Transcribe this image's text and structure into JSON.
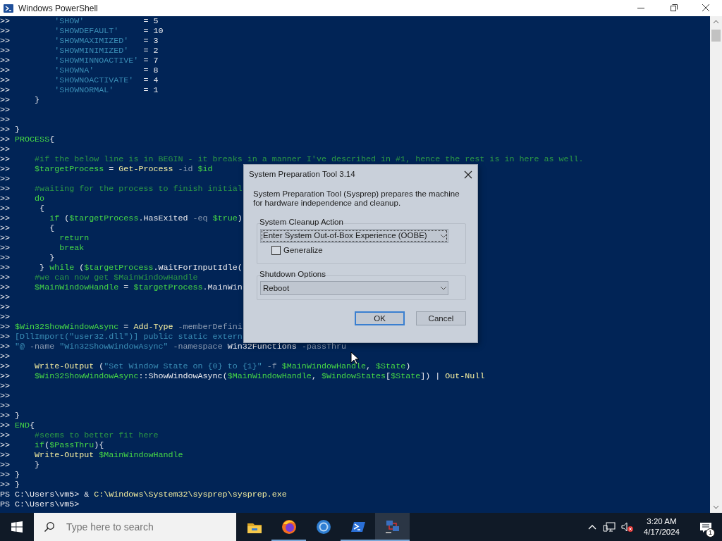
{
  "window": {
    "title": "Windows PowerShell"
  },
  "console": {
    "lines": [
      {
        "segments": [
          {
            "kind": "plain",
            "text": ">>         "
          },
          {
            "kind": "string",
            "text": "'SHOW'"
          },
          {
            "kind": "plain",
            "text": "            = 5"
          }
        ]
      },
      {
        "segments": [
          {
            "kind": "plain",
            "text": ">>         "
          },
          {
            "kind": "string",
            "text": "'SHOWDEFAULT'"
          },
          {
            "kind": "plain",
            "text": "     = 10"
          }
        ]
      },
      {
        "segments": [
          {
            "kind": "plain",
            "text": ">>         "
          },
          {
            "kind": "string",
            "text": "'SHOWMAXIMIZED'"
          },
          {
            "kind": "plain",
            "text": "   = 3"
          }
        ]
      },
      {
        "segments": [
          {
            "kind": "plain",
            "text": ">>         "
          },
          {
            "kind": "string",
            "text": "'SHOWMINIMIZED'"
          },
          {
            "kind": "plain",
            "text": "   = 2"
          }
        ]
      },
      {
        "segments": [
          {
            "kind": "plain",
            "text": ">>         "
          },
          {
            "kind": "string",
            "text": "'SHOWMINNOACTIVE'"
          },
          {
            "kind": "plain",
            "text": " = 7"
          }
        ]
      },
      {
        "segments": [
          {
            "kind": "plain",
            "text": ">>         "
          },
          {
            "kind": "string",
            "text": "'SHOWNA'"
          },
          {
            "kind": "plain",
            "text": "          = 8"
          }
        ]
      },
      {
        "segments": [
          {
            "kind": "plain",
            "text": ">>         "
          },
          {
            "kind": "string",
            "text": "'SHOWNOACTIVATE'"
          },
          {
            "kind": "plain",
            "text": "  = 4"
          }
        ]
      },
      {
        "segments": [
          {
            "kind": "plain",
            "text": ">>         "
          },
          {
            "kind": "string",
            "text": "'SHOWNORMAL'"
          },
          {
            "kind": "plain",
            "text": "      = 1"
          }
        ]
      },
      {
        "segments": [
          {
            "kind": "plain",
            "text": ">>     }"
          }
        ]
      },
      {
        "segments": [
          {
            "kind": "plain",
            "text": ">>"
          }
        ]
      },
      {
        "segments": [
          {
            "kind": "plain",
            "text": ">>"
          }
        ]
      },
      {
        "segments": [
          {
            "kind": "plain",
            "text": ">> }"
          }
        ]
      },
      {
        "segments": [
          {
            "kind": "plain",
            "text": ">> "
          },
          {
            "kind": "keyword",
            "text": "PROCESS"
          },
          {
            "kind": "plain",
            "text": "{"
          }
        ]
      },
      {
        "segments": [
          {
            "kind": "plain",
            "text": ">>"
          }
        ]
      },
      {
        "segments": [
          {
            "kind": "plain",
            "text": ">>     "
          },
          {
            "kind": "comment",
            "text": "#if the below line is in BEGIN - it breaks in a manner I've described in #1, hence the rest is in here as well."
          }
        ]
      },
      {
        "segments": [
          {
            "kind": "plain",
            "text": ">>     "
          },
          {
            "kind": "variable",
            "text": "$targetProcess"
          },
          {
            "kind": "plain",
            "text": " = "
          },
          {
            "kind": "command",
            "text": "Get-Process"
          },
          {
            "kind": "param",
            "text": " -id "
          },
          {
            "kind": "variable",
            "text": "$id"
          }
        ]
      },
      {
        "segments": [
          {
            "kind": "plain",
            "text": ">>"
          }
        ]
      },
      {
        "segments": [
          {
            "kind": "plain",
            "text": ">>     "
          },
          {
            "kind": "comment",
            "text": "#waiting for the process to finish initial"
          }
        ]
      },
      {
        "segments": [
          {
            "kind": "plain",
            "text": ">>     "
          },
          {
            "kind": "keyword",
            "text": "do"
          }
        ]
      },
      {
        "segments": [
          {
            "kind": "plain",
            "text": ">>      {"
          }
        ]
      },
      {
        "segments": [
          {
            "kind": "plain",
            "text": ">>        "
          },
          {
            "kind": "keyword",
            "text": "if"
          },
          {
            "kind": "plain",
            "text": " ("
          },
          {
            "kind": "variable",
            "text": "$targetProcess"
          },
          {
            "kind": "plain",
            "text": ".HasExited"
          },
          {
            "kind": "param",
            "text": " -eq "
          },
          {
            "kind": "variable",
            "text": "$true"
          },
          {
            "kind": "plain",
            "text": ")"
          }
        ]
      },
      {
        "segments": [
          {
            "kind": "plain",
            "text": ">>        {"
          }
        ]
      },
      {
        "segments": [
          {
            "kind": "plain",
            "text": ">>          "
          },
          {
            "kind": "keyword",
            "text": "return"
          }
        ]
      },
      {
        "segments": [
          {
            "kind": "plain",
            "text": ">>          "
          },
          {
            "kind": "keyword",
            "text": "break"
          }
        ]
      },
      {
        "segments": [
          {
            "kind": "plain",
            "text": ">>        }"
          }
        ]
      },
      {
        "segments": [
          {
            "kind": "plain",
            "text": ">>      } "
          },
          {
            "kind": "keyword",
            "text": "while"
          },
          {
            "kind": "plain",
            "text": " ("
          },
          {
            "kind": "variable",
            "text": "$targetProcess"
          },
          {
            "kind": "plain",
            "text": ".WaitForInputIdle("
          }
        ]
      },
      {
        "segments": [
          {
            "kind": "plain",
            "text": ">>     "
          },
          {
            "kind": "comment",
            "text": "#we can now get $MainWindowHandle"
          }
        ]
      },
      {
        "segments": [
          {
            "kind": "plain",
            "text": ">>     "
          },
          {
            "kind": "variable",
            "text": "$MainWindowHandle"
          },
          {
            "kind": "plain",
            "text": " = "
          },
          {
            "kind": "variable",
            "text": "$targetProcess"
          },
          {
            "kind": "plain",
            "text": ".MainWin"
          }
        ]
      },
      {
        "segments": [
          {
            "kind": "plain",
            "text": ">>"
          }
        ]
      },
      {
        "segments": [
          {
            "kind": "plain",
            "text": ">>"
          }
        ]
      },
      {
        "segments": [
          {
            "kind": "plain",
            "text": ">>"
          }
        ]
      },
      {
        "segments": [
          {
            "kind": "plain",
            "text": ">> "
          },
          {
            "kind": "variable",
            "text": "$Win32ShowWindowAsync"
          },
          {
            "kind": "plain",
            "text": " = "
          },
          {
            "kind": "command",
            "text": "Add-Type"
          },
          {
            "kind": "param",
            "text": " -memberDefini"
          }
        ]
      },
      {
        "segments": [
          {
            "kind": "plain",
            "text": ">> "
          },
          {
            "kind": "string",
            "text": "[DllImport(\"user32.dll\")] public static extern"
          }
        ]
      },
      {
        "segments": [
          {
            "kind": "plain",
            "text": ">> "
          },
          {
            "kind": "string",
            "text": "\"@"
          },
          {
            "kind": "param",
            "text": " -name "
          },
          {
            "kind": "string",
            "text": "\"Win32ShowWindowAsync\""
          },
          {
            "kind": "param",
            "text": " -namespace "
          },
          {
            "kind": "plain",
            "text": "Win32Functions"
          },
          {
            "kind": "param",
            "text": " -passThru"
          }
        ]
      },
      {
        "segments": [
          {
            "kind": "plain",
            "text": ">>"
          }
        ]
      },
      {
        "segments": [
          {
            "kind": "plain",
            "text": ">>     "
          },
          {
            "kind": "command",
            "text": "Write-Output"
          },
          {
            "kind": "plain",
            "text": " ("
          },
          {
            "kind": "string",
            "text": "\"Set Window State on {0} to {1}\""
          },
          {
            "kind": "param",
            "text": " -f "
          },
          {
            "kind": "variable",
            "text": "$MainWindowHandle"
          },
          {
            "kind": "plain",
            "text": ", "
          },
          {
            "kind": "variable",
            "text": "$State"
          },
          {
            "kind": "plain",
            "text": ")"
          }
        ]
      },
      {
        "segments": [
          {
            "kind": "plain",
            "text": ">>     "
          },
          {
            "kind": "variable",
            "text": "$Win32ShowWindowAsync"
          },
          {
            "kind": "plain",
            "text": "::ShowWindowAsync("
          },
          {
            "kind": "variable",
            "text": "$MainWindowHandle"
          },
          {
            "kind": "plain",
            "text": ", "
          },
          {
            "kind": "variable",
            "text": "$WindowStates"
          },
          {
            "kind": "plain",
            "text": "["
          },
          {
            "kind": "variable",
            "text": "$State"
          },
          {
            "kind": "plain",
            "text": "]) | "
          },
          {
            "kind": "command",
            "text": "Out-Null"
          }
        ]
      },
      {
        "segments": [
          {
            "kind": "plain",
            "text": ">>"
          }
        ]
      },
      {
        "segments": [
          {
            "kind": "plain",
            "text": ">>"
          }
        ]
      },
      {
        "segments": [
          {
            "kind": "plain",
            "text": ">>"
          }
        ]
      },
      {
        "segments": [
          {
            "kind": "plain",
            "text": ">> }"
          }
        ]
      },
      {
        "segments": [
          {
            "kind": "plain",
            "text": ">> "
          },
          {
            "kind": "keyword",
            "text": "END"
          },
          {
            "kind": "plain",
            "text": "{"
          }
        ]
      },
      {
        "segments": [
          {
            "kind": "plain",
            "text": ">>     "
          },
          {
            "kind": "comment",
            "text": "#seems to better fit here"
          }
        ]
      },
      {
        "segments": [
          {
            "kind": "plain",
            "text": ">>     "
          },
          {
            "kind": "keyword",
            "text": "if"
          },
          {
            "kind": "plain",
            "text": "("
          },
          {
            "kind": "variable",
            "text": "$PassThru"
          },
          {
            "kind": "plain",
            "text": "){"
          }
        ]
      },
      {
        "segments": [
          {
            "kind": "plain",
            "text": ">>     "
          },
          {
            "kind": "command",
            "text": "Write-Output"
          },
          {
            "kind": "variable",
            "text": " $MainWindowHandle"
          }
        ]
      },
      {
        "segments": [
          {
            "kind": "plain",
            "text": ">>     }"
          }
        ]
      },
      {
        "segments": [
          {
            "kind": "plain",
            "text": ">> }"
          }
        ]
      },
      {
        "segments": [
          {
            "kind": "plain",
            "text": ">> }"
          }
        ]
      },
      {
        "segments": [
          {
            "kind": "plain",
            "text": "PS C:\\Users\\vm5> & "
          },
          {
            "kind": "command",
            "text": "C:\\Windows\\System32\\sysprep\\sysprep.exe"
          }
        ]
      },
      {
        "segments": [
          {
            "kind": "plain",
            "text": "PS C:\\Users\\vm5>"
          }
        ]
      }
    ]
  },
  "dialog": {
    "title": "System Preparation Tool 3.14",
    "description": "System Preparation Tool (Sysprep) prepares the machine for hardware independence and cleanup.",
    "cleanup_group": {
      "label": "System Cleanup Action",
      "value": "Enter System Out-of-Box Experience (OOBE)",
      "generalize": {
        "label": "Generalize",
        "checked": false
      }
    },
    "shutdown_group": {
      "label": "Shutdown Options",
      "value": "Reboot"
    },
    "buttons": [
      {
        "label": "OK",
        "default": true
      },
      {
        "label": "Cancel",
        "default": false
      }
    ]
  },
  "taskbar": {
    "search": {
      "placeholder": "Type here to search"
    },
    "apps": [
      {
        "kind": "folder",
        "running": false,
        "selected": false
      },
      {
        "kind": "firefox",
        "running": true,
        "selected": false
      },
      {
        "kind": "browser",
        "running": false,
        "selected": false
      },
      {
        "kind": "powershell",
        "running": true,
        "selected": false
      },
      {
        "kind": "network",
        "running": true,
        "selected": true
      }
    ],
    "time": "3:20 AM",
    "date": "4/17/2024",
    "notifications": "1"
  }
}
